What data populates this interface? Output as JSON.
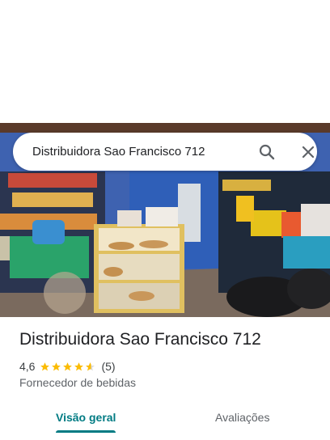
{
  "search": {
    "query": "Distribuidora Sao Francisco 712"
  },
  "place": {
    "title": "Distribuidora Sao Francisco 712",
    "rating": "4,6",
    "stars": 4.6,
    "review_count": "(5)",
    "category": "Fornecedor de bebidas"
  },
  "tabs": [
    {
      "label": "Visão geral",
      "selected": true
    },
    {
      "label": "Avaliações",
      "selected": false
    }
  ],
  "colors": {
    "accent": "#007b83",
    "star": "#fbbc04"
  },
  "icons": [
    "search-icon",
    "close-icon",
    "star-icon"
  ]
}
